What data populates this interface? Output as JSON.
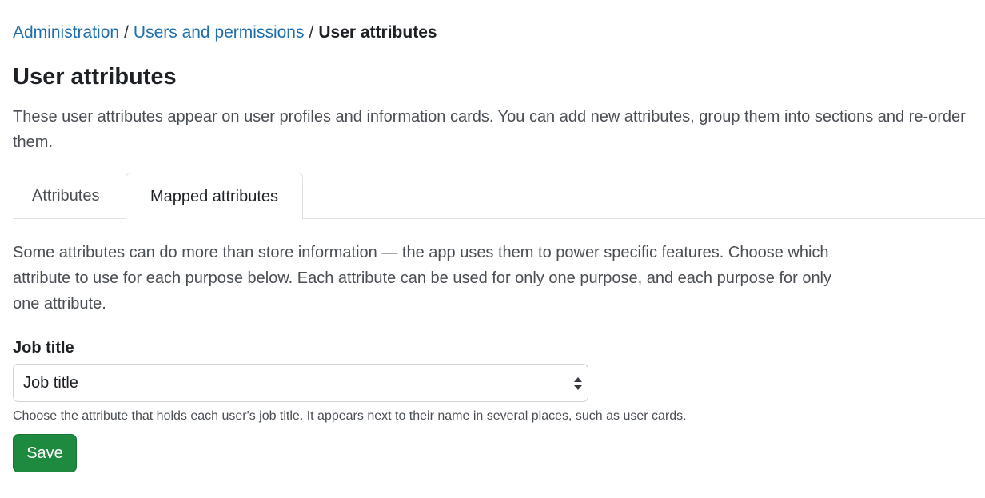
{
  "breadcrumb": {
    "items": [
      {
        "label": "Administration"
      },
      {
        "label": "Users and permissions"
      }
    ],
    "separator": "/",
    "current": "User attributes"
  },
  "page": {
    "title": "User attributes",
    "intro": "These user attributes appear on user profiles and information cards. You can add new attributes, group them into sections and re-order them."
  },
  "tabs": [
    {
      "label": "Attributes",
      "active": false
    },
    {
      "label": "Mapped attributes",
      "active": true
    }
  ],
  "mapped": {
    "description": "Some attributes can do more than store information — the app uses them to power specific features. Choose which attribute to use for each purpose below. Each attribute can be used for only one purpose, and each purpose for only one attribute.",
    "field": {
      "label": "Job title",
      "selected_value": "Job title",
      "help": "Choose the attribute that holds each user's job title. It appears next to their name in several places, such as user cards."
    },
    "save_label": "Save"
  },
  "colors": {
    "link": "#1f6fae",
    "save_button": "#1e8a3f",
    "text": "#4a4f55",
    "border": "#dee2e6"
  },
  "icons": {
    "select_caret": "select-caret-icon"
  }
}
